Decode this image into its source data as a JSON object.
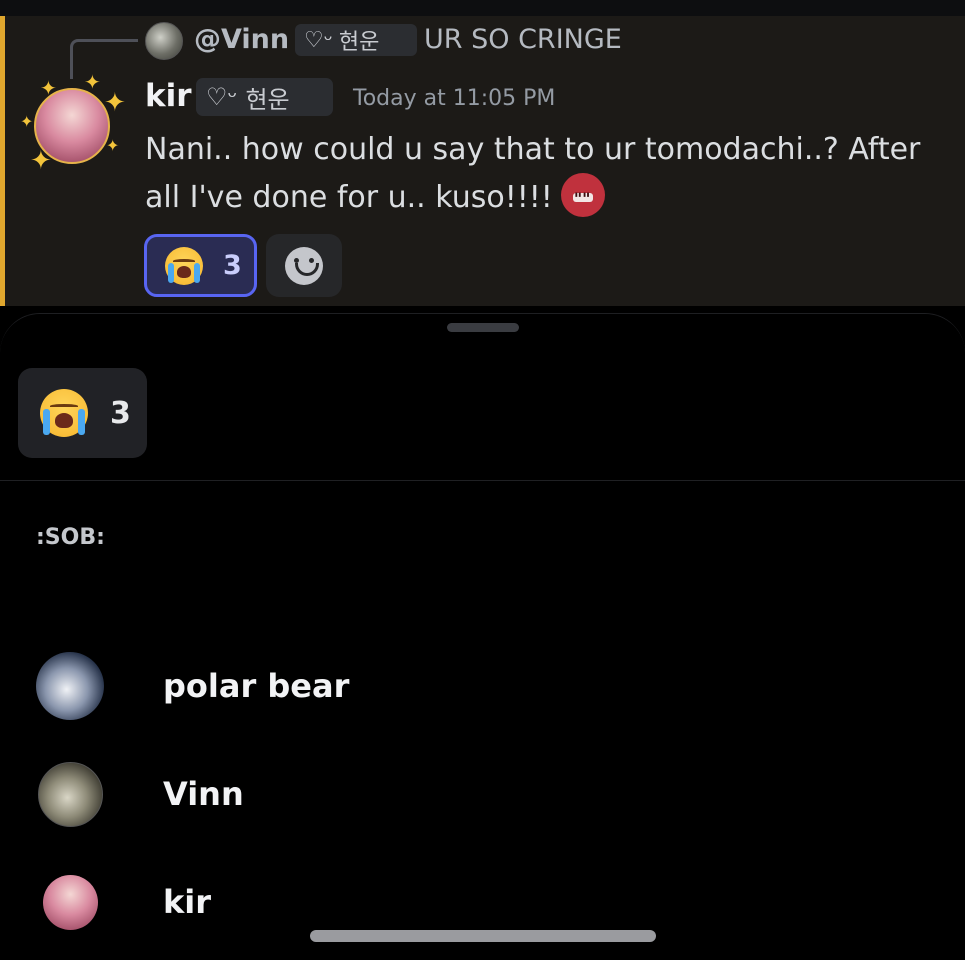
{
  "message": {
    "reply": {
      "author": "@Vinn",
      "tag_icon": "heart-icon",
      "tag_symbol": "♡ᵕ",
      "tag_text": "현운",
      "text": "UR SO CRINGE"
    },
    "author": "kir",
    "author_tag_symbol": "♡ᵕ",
    "author_tag_text": "현운",
    "timestamp": "Today at 11:05 PM",
    "text": "Nani..  how could u say that to ur tomodachi..? After all I've done for u.. kuso!!!!",
    "inline_emoji": "angry-face-emoji",
    "reactions": [
      {
        "emoji": "sob-emoji",
        "count": "3",
        "selected": true
      }
    ],
    "accent_color": "#e0a72e",
    "selected_reaction_color": "#5865f2"
  },
  "sheet": {
    "reaction_tab": {
      "emoji": "sob-emoji",
      "count": "3"
    },
    "emoji_code": ":SOB:",
    "users": [
      {
        "name": "polar bear"
      },
      {
        "name": "Vinn"
      },
      {
        "name": "kir"
      }
    ]
  }
}
